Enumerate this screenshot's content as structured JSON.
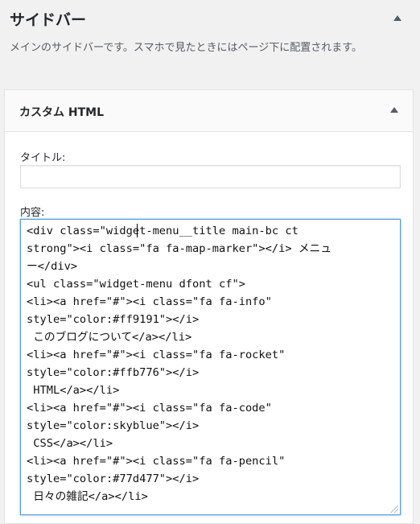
{
  "sidebar": {
    "title": "サイドバー",
    "description": "メインのサイドバーです。スマホで見たときにはページ下に配置されます。"
  },
  "widget": {
    "title": "カスタム HTML",
    "title_field_label": "タイトル:",
    "title_field_value": "",
    "content_field_label": "内容:",
    "content_lines": [
      "<div class=\"widget-menu__title main-bc ct",
      "strong\"><i class=\"fa fa-map-marker\"></i> メニュ",
      "ー</div>",
      "<ul class=\"widget-menu dfont cf\">",
      "<li><a href=\"#\"><i class=\"fa fa-info\"",
      "style=\"color:#ff9191\"></i>",
      " このブログについて</a></li>",
      "<li><a href=\"#\"><i class=\"fa fa-rocket\"",
      "style=\"color:#ffb776\"></i>",
      " HTML</a></li>",
      "<li><a href=\"#\"><i class=\"fa fa-code\"",
      "style=\"color:skyblue\"></i>",
      " CSS</a></li>",
      "<li><a href=\"#\"><i class=\"fa fa-pencil\"",
      "style=\"color:#77d477\"></i>",
      " 日々の雑記</a></li>"
    ]
  },
  "icons": {
    "collapse": "triangle-up-icon",
    "resize": "resize-grip-icon"
  },
  "colors": {
    "focus_border": "#5b9dd9",
    "background": "#f1f1f1",
    "panel": "#ffffff"
  }
}
